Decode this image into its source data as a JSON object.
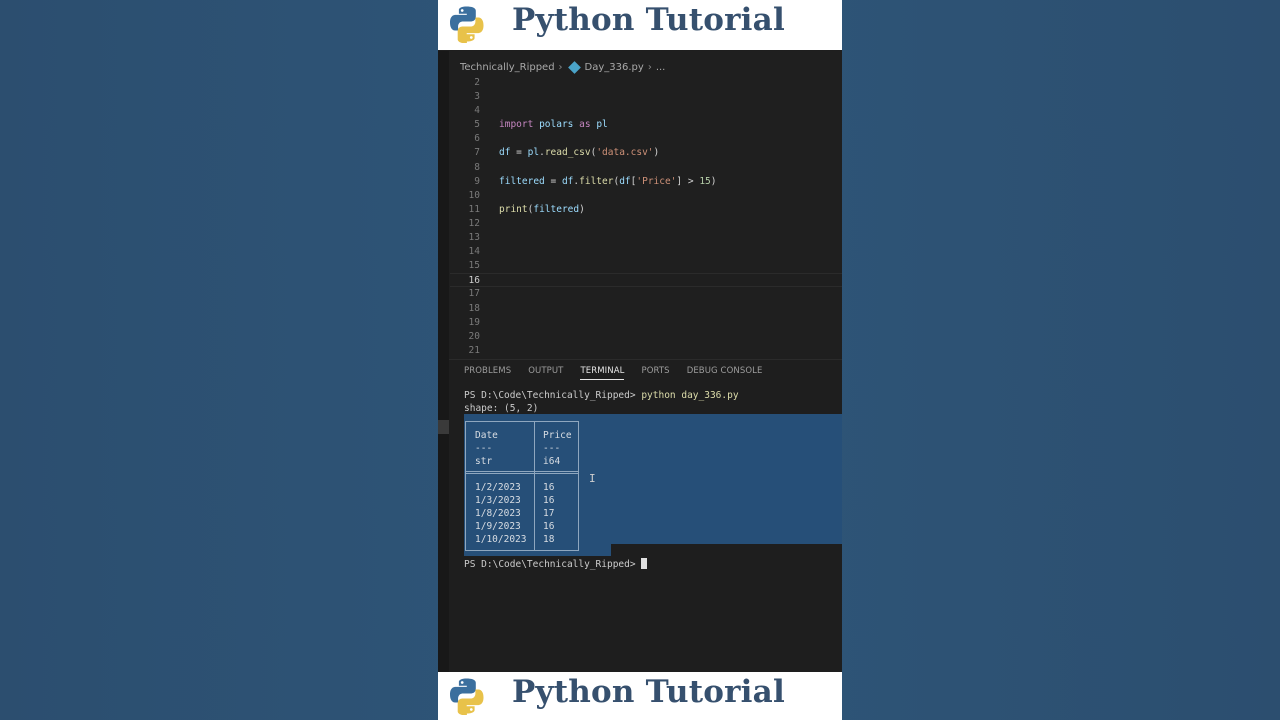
{
  "banner": {
    "title": "Python Tutorial"
  },
  "breadcrumb": {
    "folder": "Technically_Ripped",
    "file": "Day_336.py",
    "more": "..."
  },
  "editor": {
    "active_line": "16",
    "lines": [
      {
        "n": "2"
      },
      {
        "n": "3"
      },
      {
        "n": "4"
      },
      {
        "n": "5",
        "t": [
          [
            "kw",
            "import"
          ],
          [
            "p",
            " "
          ],
          [
            "var",
            "polars"
          ],
          [
            "p",
            " "
          ],
          [
            "kw",
            "as"
          ],
          [
            "p",
            " "
          ],
          [
            "var",
            "pl"
          ]
        ]
      },
      {
        "n": "6"
      },
      {
        "n": "7",
        "t": [
          [
            "var",
            "df"
          ],
          [
            "p",
            " = "
          ],
          [
            "var",
            "pl"
          ],
          [
            "p",
            "."
          ],
          [
            "fn",
            "read_csv"
          ],
          [
            "p",
            "("
          ],
          [
            "str",
            "'data.csv'"
          ],
          [
            "p",
            ")"
          ]
        ]
      },
      {
        "n": "8"
      },
      {
        "n": "9",
        "t": [
          [
            "var",
            "filtered"
          ],
          [
            "p",
            " = "
          ],
          [
            "var",
            "df"
          ],
          [
            "p",
            "."
          ],
          [
            "fn",
            "filter"
          ],
          [
            "p",
            "("
          ],
          [
            "var",
            "df"
          ],
          [
            "p",
            "["
          ],
          [
            "str",
            "'Price'"
          ],
          [
            "p",
            "] > "
          ],
          [
            "num",
            "15"
          ],
          [
            "p",
            ")"
          ]
        ]
      },
      {
        "n": "10"
      },
      {
        "n": "11",
        "t": [
          [
            "fn",
            "print"
          ],
          [
            "p",
            "("
          ],
          [
            "var",
            "filtered"
          ],
          [
            "p",
            ")"
          ]
        ]
      },
      {
        "n": "12"
      },
      {
        "n": "13"
      },
      {
        "n": "14"
      },
      {
        "n": "15"
      },
      {
        "n": "16"
      },
      {
        "n": "17"
      },
      {
        "n": "18"
      },
      {
        "n": "19"
      },
      {
        "n": "20"
      },
      {
        "n": "21"
      }
    ]
  },
  "panel": {
    "tabs": [
      "PROBLEMS",
      "OUTPUT",
      "TERMINAL",
      "PORTS",
      "DEBUG CONSOLE"
    ],
    "active_tab": "TERMINAL"
  },
  "terminal": {
    "prompt1": "PS D:\\Code\\Technically_Ripped> ",
    "command": "python day_336.py",
    "shape": "shape: (5, 2)",
    "table": {
      "headers": [
        "Date",
        "Price"
      ],
      "dashes": [
        "---",
        "---"
      ],
      "dtypes": [
        "str",
        "i64"
      ],
      "rows": [
        [
          "1/2/2023",
          "16"
        ],
        [
          "1/3/2023",
          "16"
        ],
        [
          "1/8/2023",
          "17"
        ],
        [
          "1/9/2023",
          "16"
        ],
        [
          "1/10/2023",
          "18"
        ]
      ]
    },
    "prompt2": "PS D:\\Code\\Technically_Ripped> "
  },
  "colors": {
    "background": "#2c4e6f",
    "banner_text": "#36506e",
    "selection": "#264f78",
    "editor_bg": "#1f1f1f"
  }
}
